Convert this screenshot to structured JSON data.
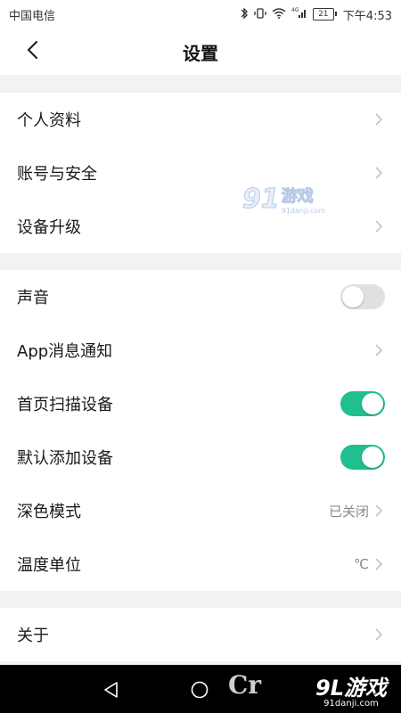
{
  "status_bar": {
    "carrier": "中国电信",
    "battery": "21",
    "time": "下午4:53"
  },
  "header": {
    "title": "设置"
  },
  "groups": [
    {
      "items": [
        {
          "label": "个人资料"
        },
        {
          "label": "账号与安全"
        },
        {
          "label": "设备升级"
        }
      ]
    },
    {
      "items": [
        {
          "label": "声音",
          "toggle": false
        },
        {
          "label": "App消息通知"
        },
        {
          "label": "首页扫描设备",
          "toggle": true
        },
        {
          "label": "默认添加设备",
          "toggle": true
        },
        {
          "label": "深色模式",
          "value": "已关闭"
        },
        {
          "label": "温度单位",
          "value": "℃"
        }
      ]
    },
    {
      "items": [
        {
          "label": "关于"
        }
      ]
    }
  ],
  "watermark": {
    "logo": "91",
    "name": "游戏",
    "url": "91danji.com"
  },
  "nav_bar": {
    "partial_logo": "Cr",
    "brand_logo": "9L游戏",
    "brand_url": "91danji.com"
  },
  "colors": {
    "toggle_on": "#1fbf8f",
    "toggle_off": "#e0e0e0",
    "background": "#f2f2f2"
  },
  "icons": [
    "back-arrow-icon",
    "chevron-right-icon",
    "bluetooth-icon",
    "vibrate-icon",
    "wifi-icon",
    "signal-icon",
    "battery-icon",
    "nav-back-icon",
    "nav-home-icon"
  ]
}
